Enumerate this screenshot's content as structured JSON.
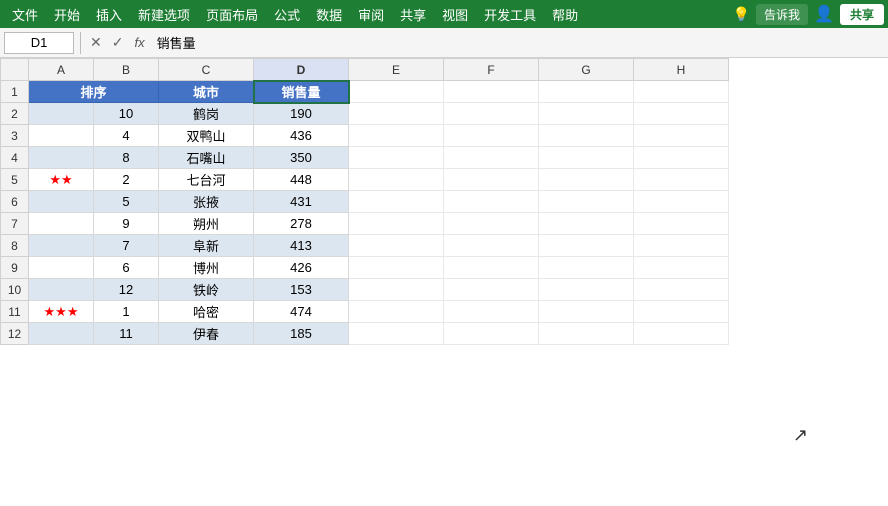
{
  "menu": {
    "items": [
      "文件",
      "开始",
      "插入",
      "新建选项",
      "页面布局",
      "公式",
      "数据",
      "审阅",
      "共享",
      "视图",
      "开发工具",
      "帮助"
    ],
    "tell_me": "告诉我",
    "share": "共享"
  },
  "formula_bar": {
    "cell_ref": "D1",
    "formula_value": "销售量",
    "cancel_icon": "✕",
    "confirm_icon": "✓",
    "fx_icon": "fx"
  },
  "columns": {
    "headers": [
      "",
      "A",
      "B",
      "C",
      "D",
      "E",
      "F",
      "G",
      "H"
    ],
    "widths": [
      28,
      65,
      65,
      95,
      95,
      95,
      95,
      95,
      95
    ]
  },
  "rows": [
    {
      "row_num": "1",
      "cells": [
        "排序",
        "",
        "城市",
        "销售量",
        "",
        "",
        "",
        ""
      ]
    },
    {
      "row_num": "2",
      "cells": [
        "",
        "10",
        "鹤岗",
        "190",
        "",
        "",
        "",
        ""
      ]
    },
    {
      "row_num": "3",
      "cells": [
        "",
        "4",
        "双鸭山",
        "436",
        "",
        "",
        "",
        ""
      ]
    },
    {
      "row_num": "4",
      "cells": [
        "",
        "8",
        "石嘴山",
        "350",
        "",
        "",
        "",
        ""
      ]
    },
    {
      "row_num": "5",
      "cells": [
        "★★",
        "2",
        "七台河",
        "448",
        "",
        "",
        "",
        ""
      ]
    },
    {
      "row_num": "6",
      "cells": [
        "",
        "5",
        "张掖",
        "431",
        "",
        "",
        "",
        ""
      ]
    },
    {
      "row_num": "7",
      "cells": [
        "",
        "9",
        "朔州",
        "278",
        "",
        "",
        "",
        ""
      ]
    },
    {
      "row_num": "8",
      "cells": [
        "",
        "7",
        "阜新",
        "413",
        "",
        "",
        "",
        ""
      ]
    },
    {
      "row_num": "9",
      "cells": [
        "",
        "6",
        "博州",
        "426",
        "",
        "",
        "",
        ""
      ]
    },
    {
      "row_num": "10",
      "cells": [
        "",
        "12",
        "铁岭",
        "153",
        "",
        "",
        "",
        ""
      ]
    },
    {
      "row_num": "11",
      "cells": [
        "★★★",
        "1",
        "哈密",
        "474",
        "",
        "",
        "",
        ""
      ]
    },
    {
      "row_num": "12",
      "cells": [
        "",
        "11",
        "伊春",
        "185",
        "",
        "",
        "",
        ""
      ]
    }
  ],
  "header_row_labels": [
    "排序",
    "城市",
    "销售量"
  ],
  "selected_cell": "D1",
  "colors": {
    "menu_bg": "#1e7e34",
    "header_cell_bg": "#4472c4",
    "data_row_blue": "#dce6f1",
    "data_row_white": "#ffffff",
    "border": "#d0d0d0"
  }
}
